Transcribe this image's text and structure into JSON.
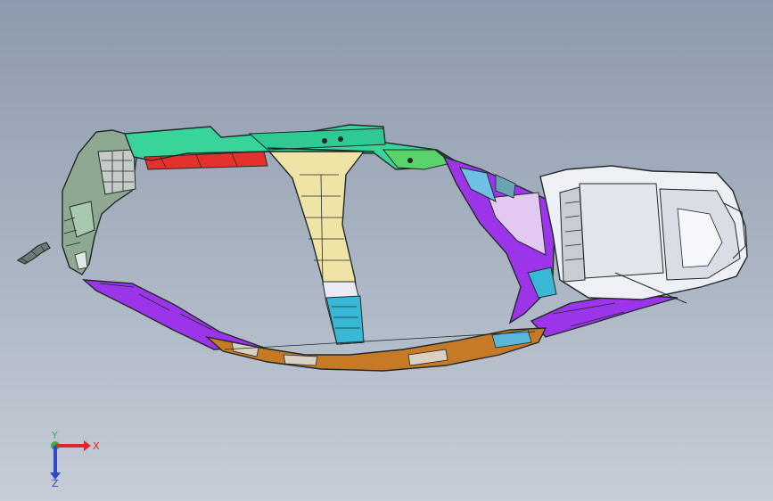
{
  "viewport": {
    "background_top": "#8d9aad",
    "background_bottom": "#c6cdd7"
  },
  "model": {
    "part_colors": {
      "frame_outline": "#1f2a2a",
      "upper_rail_green": "#38d49a",
      "upper_rail_red": "#e4312b",
      "center_pillar_yellow": "#efe4a6",
      "center_pillar_cyan": "#39b7d6",
      "lower_arc_orange": "#c67a26",
      "trim_purple": "#9c35ea",
      "rear_box_white": "#eef0f5",
      "front_shell_gray": "#8ea892"
    }
  },
  "triad": {
    "x_label": "X",
    "y_label": "Y",
    "z_label": "Z",
    "x_color": "#e0262d",
    "y_color": "#2bb84a",
    "z_color": "#2c49c9"
  }
}
